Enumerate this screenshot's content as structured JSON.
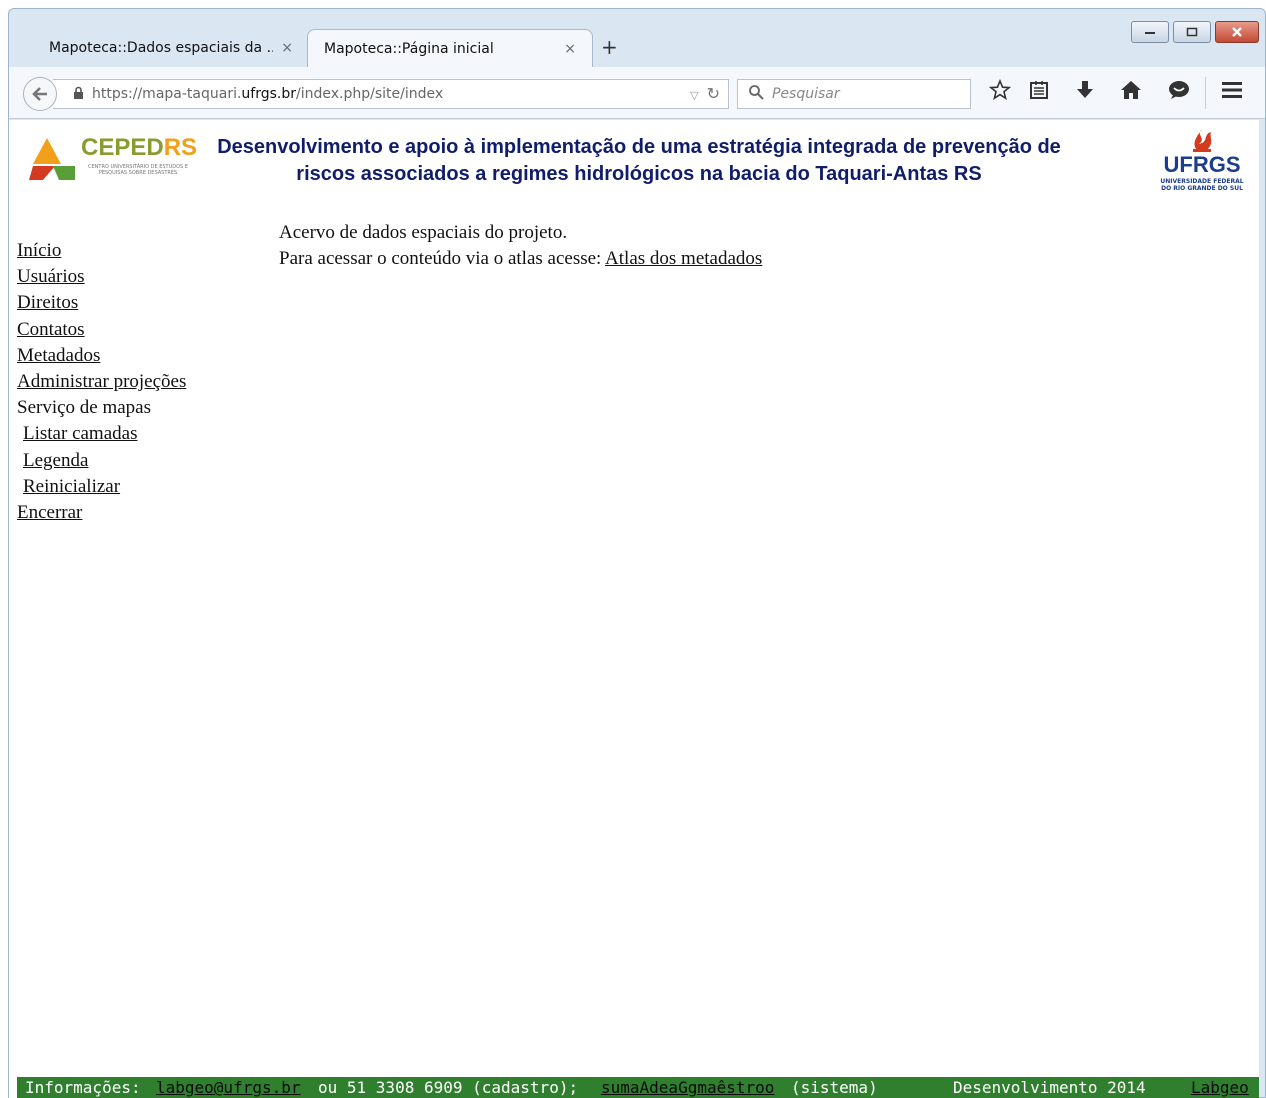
{
  "browser": {
    "tabs": [
      {
        "label": "Mapoteca::Dados espaciais da ...",
        "close": "×"
      },
      {
        "label": "Mapoteca::Página inicial",
        "close": "×"
      }
    ],
    "new_tab": "+",
    "url_prefix": "https://mapa-taquari.",
    "url_host": "ufrgs.br",
    "url_tail": "/index.php/site/index",
    "search_placeholder": "Pesquisar",
    "icons": [
      "back-arrow-icon",
      "lock-icon",
      "dropdown-icon",
      "reload-icon",
      "search-icon",
      "star-icon",
      "reading-list-icon",
      "download-icon",
      "home-icon",
      "chat-icon",
      "menu-icon"
    ]
  },
  "header": {
    "left_logo": "CEPEDRS",
    "left_logo_part1": "CEPED",
    "left_logo_part2": "RS",
    "left_logo_sub": "CENTRO UNIVERSITÁRIO DE ESTUDOS E PESQUISAS SOBRE DESASTRES",
    "title_line1": "Desenvolvimento e apoio à implementação de uma estratégia integrada de prevenção de",
    "title_line2": "riscos associados a regimes hidrológicos na bacia do Taquari-Antas RS",
    "right_logo": "UFRGS",
    "right_logo_sub1": "UNIVERSIDADE FEDERAL",
    "right_logo_sub2": "DO RIO GRANDE DO SUL"
  },
  "menu": {
    "inicio": "Início",
    "usuarios": "Usuários",
    "direitos": "Direitos",
    "contatos": "Contatos",
    "metadados": "Metadados",
    "administrar": "Administrar projeções",
    "servico": "Serviço de mapas",
    "listar": "Listar camadas",
    "legenda": "Legenda",
    "reinicializar": "Reinicializar",
    "encerrar": "Encerrar"
  },
  "main": {
    "line1": "Acervo de dados espaciais do projeto.",
    "line2_prefix": "Para acessar o conteúdo via o atlas acesse: ",
    "atlas_link": "Atlas dos metadados"
  },
  "footer": {
    "info_label": "Informações:",
    "email1": "labgeo@ufrgs.br",
    "phone": "ou 51 3308 6909 (cadastro);",
    "email2": "sumaAdeaGgmaêstroo",
    "sistema": "(sistema)",
    "dev": "Desenvolvimento 2014",
    "labgeo": "Labgeo"
  },
  "colors": {
    "title": "#101d6b",
    "footer_bg": "#2f7f2f",
    "ufrgs_blue": "#1b3c8f",
    "ufrgs_red": "#d43a1f"
  }
}
